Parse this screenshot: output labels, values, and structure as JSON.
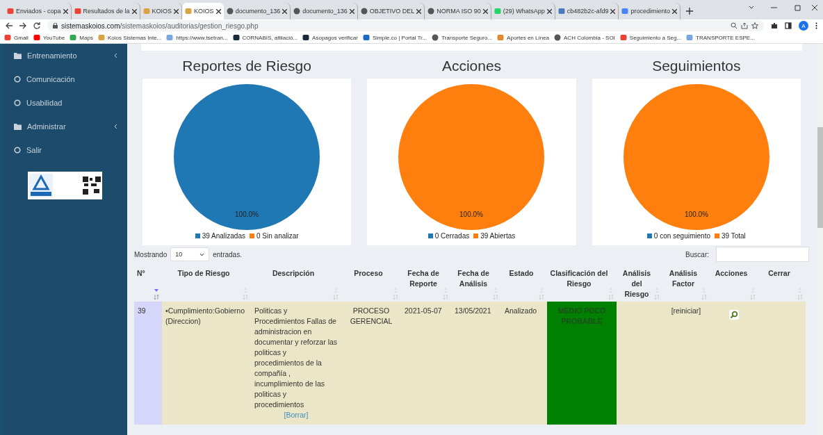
{
  "browser": {
    "tabs": [
      {
        "title": "Enviados - copa",
        "kind": "gmail",
        "selected": false
      },
      {
        "title": "Resultados de la",
        "kind": "gmail",
        "selected": false
      },
      {
        "title": "KOIOS",
        "kind": "koios",
        "selected": false
      },
      {
        "title": "KOIOS",
        "kind": "koios",
        "selected": true
      },
      {
        "title": "documento_136",
        "kind": "globe",
        "selected": false
      },
      {
        "title": "documento_136",
        "kind": "globe",
        "selected": false
      },
      {
        "title": "OBJETIVO DEL",
        "kind": "globe",
        "selected": false
      },
      {
        "title": "NORMA ISO 90",
        "kind": "globe",
        "selected": false
      },
      {
        "title": "(29) WhatsApp",
        "kind": "whatsapp",
        "selected": false
      },
      {
        "title": "cb482b2c-afd9",
        "kind": "doc",
        "selected": false
      },
      {
        "title": "procedimiento",
        "kind": "google",
        "selected": false
      }
    ],
    "url_host": "sistemaskoios.com",
    "url_path": "/sistemaskoios/auditorias/gestion_riesgo.php",
    "profile": "A",
    "bookmarks": [
      {
        "title": "Gmail",
        "kind": "gmail"
      },
      {
        "title": "YouTube",
        "kind": "youtube"
      },
      {
        "title": "Maps",
        "kind": "maps"
      },
      {
        "title": "Koios Sistemas Inte...",
        "kind": "koios"
      },
      {
        "title": "https://www.tsetran...",
        "kind": "g"
      },
      {
        "title": "CORNABIS, afiliació...",
        "kind": "dark"
      },
      {
        "title": "Asopagos verificar",
        "kind": "dark"
      },
      {
        "title": "Simple.co | Portal Tr...",
        "kind": "si"
      },
      {
        "title": "Transporte Seguro...",
        "kind": "globe"
      },
      {
        "title": "Aportes en Línea",
        "kind": "dots"
      },
      {
        "title": "ACH Colombia - SOI",
        "kind": "globe"
      },
      {
        "title": "Seguimiento a Seg...",
        "kind": "gmail"
      },
      {
        "title": "TRANSPORTE ESPE...",
        "kind": "g"
      }
    ]
  },
  "sidebar": {
    "items": [
      {
        "label": "Entrenamiento",
        "kind": "folder"
      },
      {
        "label": "Comunicación",
        "kind": "link"
      },
      {
        "label": "Usabilidad",
        "kind": "link"
      },
      {
        "label": "Administrar",
        "kind": "folder"
      },
      {
        "label": "Salir",
        "kind": "link"
      }
    ]
  },
  "charts": [
    {
      "title": "Reportes de Riesgo",
      "chart_data": {
        "type": "pie",
        "categories": [
          "39 Analizadas",
          "0 Sin analizar"
        ],
        "values": [
          100,
          0
        ],
        "value_labels": [
          "100.0%",
          null
        ]
      }
    },
    {
      "title": "Acciones",
      "chart_data": {
        "type": "pie",
        "categories": [
          "0 Cerradas",
          "39 Abiertas"
        ],
        "values": [
          0,
          100
        ],
        "value_labels": [
          null,
          "100.0%"
        ]
      }
    },
    {
      "title": "Seguimientos",
      "chart_data": {
        "type": "pie",
        "categories": [
          "0 con seguimiento",
          "39 Total"
        ],
        "values": [
          0,
          100
        ],
        "value_labels": [
          null,
          "100.0%"
        ]
      }
    }
  ],
  "table": {
    "length_label_before": "Mostrando",
    "length_value": "10",
    "length_label_after": "entradas.",
    "search_label": "Buscar:",
    "columns": [
      {
        "label": "N°",
        "sorted": true
      },
      {
        "label": "Tipo de Riesgo",
        "sorted": false
      },
      {
        "label": "Descripción",
        "sorted": false
      },
      {
        "label": "Proceso",
        "sorted": false
      },
      {
        "label": "Fecha de Reporte",
        "sorted": false
      },
      {
        "label": "Fecha de Análisis",
        "sorted": false
      },
      {
        "label": "Estado",
        "sorted": false
      },
      {
        "label": "Clasificación del Riesgo",
        "sorted": false
      },
      {
        "label": "Análisis del Riesgo",
        "sorted": false
      },
      {
        "label": "Análisis Factor",
        "sorted": false
      },
      {
        "label": "Acciones",
        "sorted": false
      },
      {
        "label": "Cerrar",
        "sorted": false
      }
    ],
    "rows": [
      {
        "number": "39",
        "type": "•Cumplimiento:Gobierno (Direccion)",
        "description": "Politicas y Procedimientos Fallas de administracion en documentar y reforzar las politicas y procedimientos de la compañía , incumplimiento de las politicas y procedimientos",
        "delete_link": "[Borrar]",
        "process": "PROCESO GERENCIAL",
        "report_date": "2021-05-07",
        "analysis_date": "13/05/2021",
        "status": "Analizado",
        "classification": "MEDIO POCO PROBABLE",
        "factor_link": "[reiniciar]"
      }
    ]
  }
}
